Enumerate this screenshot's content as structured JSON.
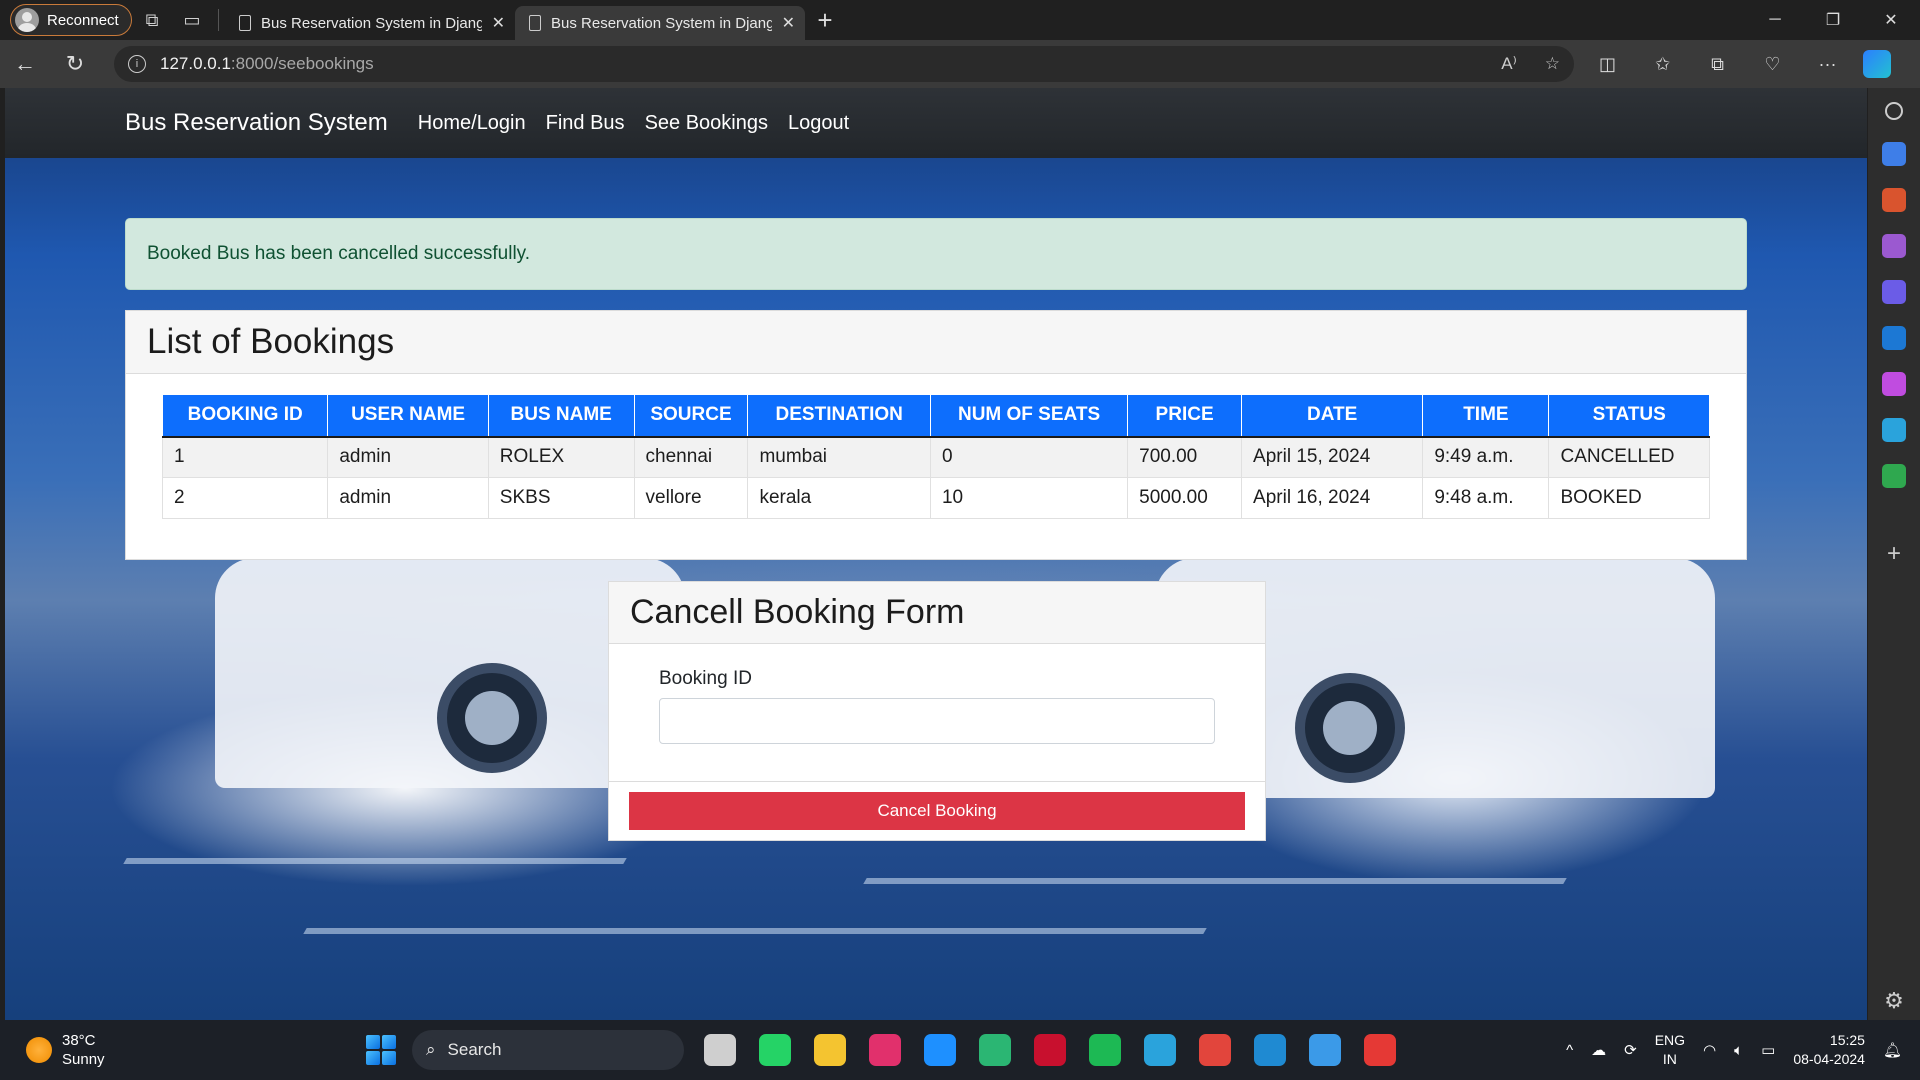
{
  "browser": {
    "profile_label": "Reconnect",
    "tabs": [
      {
        "title": "Bus Reservation System in Django"
      },
      {
        "title": "Bus Reservation System in Django"
      }
    ],
    "url_host": "127.0.0.1",
    "url_path": ":8000/seebookings"
  },
  "navbar": {
    "brand": "Bus Reservation System",
    "links": [
      "Home/Login",
      "Find Bus",
      "See Bookings",
      "Logout"
    ]
  },
  "alert": {
    "message": "Booked Bus has been cancelled successfully.",
    "color": "#d2e8de"
  },
  "bookings": {
    "title": "List of Bookings",
    "columns": [
      "BOOKING ID",
      "USER NAME",
      "BUS NAME",
      "SOURCE",
      "DESTINATION",
      "NUM OF SEATS",
      "PRICE",
      "DATE",
      "TIME",
      "STATUS"
    ],
    "rows": [
      [
        "1",
        "admin",
        "ROLEX",
        "chennai",
        "mumbai",
        "0",
        "700.00",
        "April 15, 2024",
        "9:49 a.m.",
        "CANCELLED"
      ],
      [
        "2",
        "admin",
        "SKBS",
        "vellore",
        "kerala",
        "10",
        "5000.00",
        "April 16, 2024",
        "9:48 a.m.",
        "BOOKED"
      ]
    ],
    "header_color": "#0d6efd"
  },
  "cancel_form": {
    "title": "Cancell Booking Form",
    "field_label": "Booking ID",
    "field_value": "",
    "button_label": "Cancel Booking",
    "button_color": "#dc3545"
  },
  "taskbar": {
    "weather_temp": "38°C",
    "weather_desc": "Sunny",
    "search_placeholder": "Search",
    "lang_line1": "ENG",
    "lang_line2": "IN",
    "time": "15:25",
    "date": "08-04-2024",
    "apps": [
      {
        "name": "task-view-icon",
        "color": "#cfcfcf"
      },
      {
        "name": "whatsapp-icon",
        "color": "#25d366"
      },
      {
        "name": "file-explorer-icon",
        "color": "#f4c430"
      },
      {
        "name": "instagram-icon",
        "color": "#e1306c"
      },
      {
        "name": "help-icon",
        "color": "#1e90ff"
      },
      {
        "name": "edge-icon",
        "color": "#2bb673"
      },
      {
        "name": "mcafee-icon",
        "color": "#c8102e"
      },
      {
        "name": "spotify-icon",
        "color": "#1db954"
      },
      {
        "name": "telegram-icon",
        "color": "#2aa3dc"
      },
      {
        "name": "chrome-icon",
        "color": "#e2453c"
      },
      {
        "name": "vscode-icon",
        "color": "#1f8ad2"
      },
      {
        "name": "photos-icon",
        "color": "#3b9ae8"
      },
      {
        "name": "office-icon",
        "color": "#e53935"
      }
    ]
  }
}
